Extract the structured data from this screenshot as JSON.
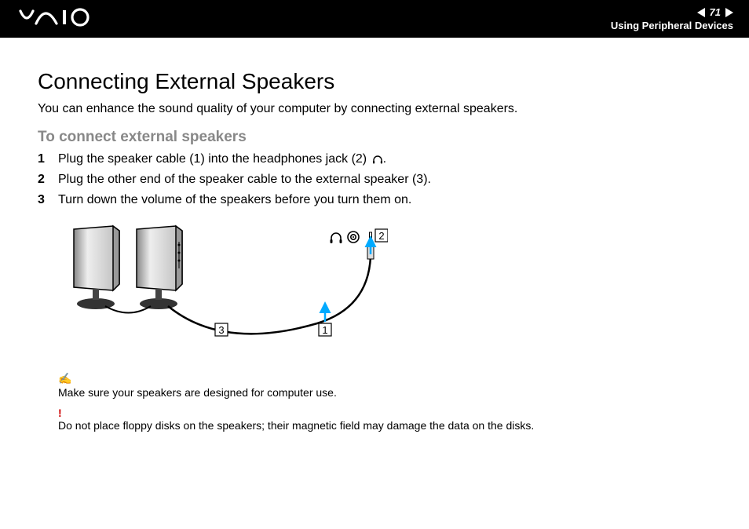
{
  "header": {
    "page_number": "71",
    "section": "Using Peripheral Devices"
  },
  "brand": "VAIO",
  "main_title": "Connecting External Speakers",
  "intro": "You can enhance the sound quality of your computer by connecting external speakers.",
  "subhead": "To connect external speakers",
  "steps": [
    {
      "num": "1",
      "text_before": "Plug the speaker cable (1) into the headphones jack (2) ",
      "text_after": ".",
      "has_icon": true
    },
    {
      "num": "2",
      "text_before": "Plug the other end of the speaker cable to the external speaker (3).",
      "text_after": "",
      "has_icon": false
    },
    {
      "num": "3",
      "text_before": "Turn down the volume of the speakers before you turn them on.",
      "text_after": "",
      "has_icon": false
    }
  ],
  "diagram": {
    "callouts": {
      "cable": "1",
      "jack": "2",
      "speaker": "3"
    },
    "headphones_icon": "headphones",
    "target_icon": "port-target"
  },
  "notes": {
    "tip_icon": "✍",
    "tip": "Make sure your speakers are designed for computer use.",
    "warn_icon": "!",
    "warn": "Do not place floppy disks on the speakers; their magnetic field may damage the data on the disks."
  }
}
